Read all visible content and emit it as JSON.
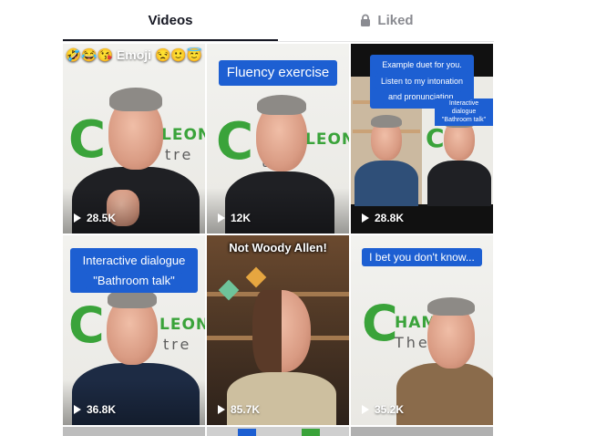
{
  "tabs": {
    "videos_label": "Videos",
    "liked_label": "Liked",
    "active": "videos"
  },
  "icons": {
    "lock": "lock-icon",
    "play": "play-icon"
  },
  "colors": {
    "caption_bg": "#1d5fd2",
    "logo_green": "#3aa33a",
    "active_tab": "#161823",
    "inactive_tab": "#8a8b91"
  },
  "videos": [
    {
      "caption_top": "🤣😂😘 Emoji 😒🙂😇",
      "caption_lines": [],
      "views": "28.5K"
    },
    {
      "caption_top": "",
      "caption_lines": [
        "Fluency exercise"
      ],
      "views": "12K"
    },
    {
      "caption_top": "",
      "caption_lines": [
        "Example duet for you.",
        "Listen to my intonation",
        "and pronunciation."
      ],
      "caption_secondary": [
        "Interactive dialogue",
        "\"Bathroom talk\""
      ],
      "views": "28.8K"
    },
    {
      "caption_top": "",
      "caption_lines": [
        "Interactive dialogue",
        "\"Bathroom talk\""
      ],
      "views": "36.8K"
    },
    {
      "caption_top": "Not Woody Allen!",
      "caption_lines": [],
      "views": "85.7K"
    },
    {
      "caption_top": "",
      "caption_lines": [
        "I bet you don't know..."
      ],
      "views": "35.2K"
    }
  ],
  "logo": {
    "part1": "C",
    "part2": "LEON",
    "part3": "tre",
    "part1b": "HAM",
    "part3b": "The"
  }
}
